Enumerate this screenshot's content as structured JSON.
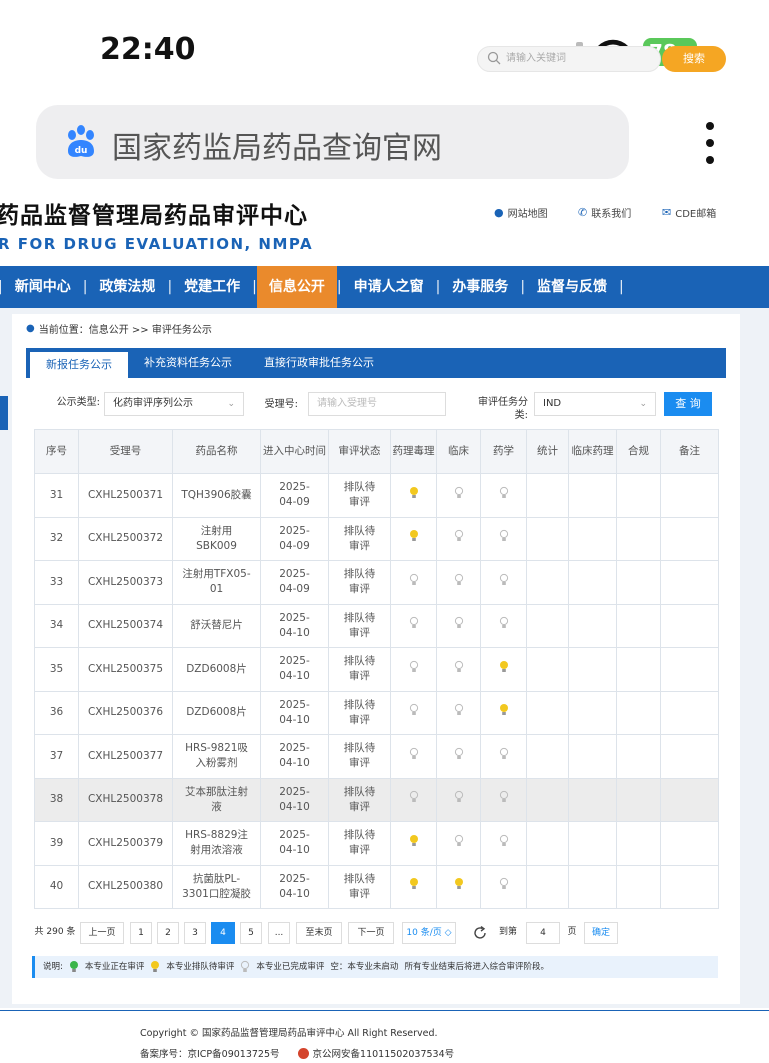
{
  "status_bar": {
    "time": "22:40",
    "battery": "78"
  },
  "browser": {
    "search_text": "国家药监局药品查询官网"
  },
  "site": {
    "title_cn": "药品监督管理局药品审评中心",
    "title_en": "R FOR DRUG EVALUATION, NMPA",
    "top_links": [
      "网站地图",
      "联系我们",
      "CDE邮箱"
    ],
    "search_placeholder": "请输入关键词",
    "search_button": "搜索"
  },
  "nav": {
    "items": [
      "新闻中心",
      "政策法规",
      "党建工作",
      "信息公开",
      "申请人之窗",
      "办事服务",
      "监督与反馈"
    ],
    "active": "信息公开"
  },
  "breadcrumb": "当前位置：信息公开 >> 审评任务公示",
  "tabs": [
    "新报任务公示",
    "补充资料任务公示",
    "直接行政审批任务公示"
  ],
  "filters": {
    "type_label": "公示类型:",
    "type_value": "化药审评序列公示",
    "accept_label": "受理号:",
    "accept_placeholder": "请输入受理号",
    "task_label": "审评任务分类:",
    "task_value": "IND",
    "query_button": "查 询"
  },
  "table": {
    "headers": [
      "序号",
      "受理号",
      "药品名称",
      "进入中心时间",
      "审评状态",
      "药理毒理",
      "临床",
      "药学",
      "统计",
      "临床药理",
      "合规",
      "备注"
    ],
    "rows": [
      {
        "no": "31",
        "id": "CXHL2500371",
        "name": "TQH3906胶囊",
        "date": "2025-04-09",
        "status": "排队待审评",
        "pharm": "yellow",
        "clin": "gray",
        "chem": "gray",
        "highlight": false
      },
      {
        "no": "32",
        "id": "CXHL2500372",
        "name": "注射用SBK009",
        "date": "2025-04-09",
        "status": "排队待审评",
        "pharm": "yellow",
        "clin": "gray",
        "chem": "gray",
        "highlight": false
      },
      {
        "no": "33",
        "id": "CXHL2500373",
        "name": "注射用TFX05-01",
        "date": "2025-04-09",
        "status": "排队待审评",
        "pharm": "gray",
        "clin": "gray",
        "chem": "gray",
        "highlight": false
      },
      {
        "no": "34",
        "id": "CXHL2500374",
        "name": "舒沃替尼片",
        "date": "2025-04-10",
        "status": "排队待审评",
        "pharm": "gray",
        "clin": "gray",
        "chem": "gray",
        "highlight": false
      },
      {
        "no": "35",
        "id": "CXHL2500375",
        "name": "DZD6008片",
        "date": "2025-04-10",
        "status": "排队待审评",
        "pharm": "gray",
        "clin": "gray",
        "chem": "yellow",
        "highlight": false
      },
      {
        "no": "36",
        "id": "CXHL2500376",
        "name": "DZD6008片",
        "date": "2025-04-10",
        "status": "排队待审评",
        "pharm": "gray",
        "clin": "gray",
        "chem": "yellow",
        "highlight": false
      },
      {
        "no": "37",
        "id": "CXHL2500377",
        "name": "HRS-9821吸入粉雾剂",
        "date": "2025-04-10",
        "status": "排队待审评",
        "pharm": "gray",
        "clin": "gray",
        "chem": "gray",
        "highlight": false
      },
      {
        "no": "38",
        "id": "CXHL2500378",
        "name": "艾本那肽注射液",
        "date": "2025-04-10",
        "status": "排队待审评",
        "pharm": "gray",
        "clin": "gray",
        "chem": "gray",
        "highlight": true
      },
      {
        "no": "39",
        "id": "CXHL2500379",
        "name": "HRS-8829注射用浓溶液",
        "date": "2025-04-10",
        "status": "排队待审评",
        "pharm": "yellow",
        "clin": "gray",
        "chem": "gray",
        "highlight": false
      },
      {
        "no": "40",
        "id": "CXHL2500380",
        "name": "抗菌肽PL-3301口腔凝胶",
        "date": "2025-04-10",
        "status": "排队待审评",
        "pharm": "yellow",
        "clin": "yellow",
        "chem": "gray",
        "highlight": false
      }
    ]
  },
  "pager": {
    "total": "共 290 条",
    "prev": "上一页",
    "pages": [
      "1",
      "2",
      "3",
      "4",
      "5",
      "..."
    ],
    "current": "4",
    "last": "至末页",
    "next": "下一页",
    "per_page": "10 条/页 ◇",
    "goto_label": "到第",
    "goto_value": "4",
    "page_unit": "页",
    "confirm": "确定"
  },
  "legend": {
    "title": "说明:",
    "green": "本专业正在审评",
    "yellow": "本专业排队待审评",
    "gray": "本专业已完成审评",
    "empty": "空：本专业未启动",
    "note": "所有专业结束后将进入综合审评阶段。"
  },
  "footer": {
    "copyright": "Copyright © 国家药品监督管理局药品审评中心  All Right Reserved.",
    "icp": "备案序号：京ICP备09013725号",
    "police": "京公网安备11011502037534号"
  },
  "colors": {
    "brand": "#1a63b6",
    "accent": "#ea8a2c",
    "bulb_yellow": "#f2c81f",
    "bulb_gray": "#c9c9c9"
  }
}
